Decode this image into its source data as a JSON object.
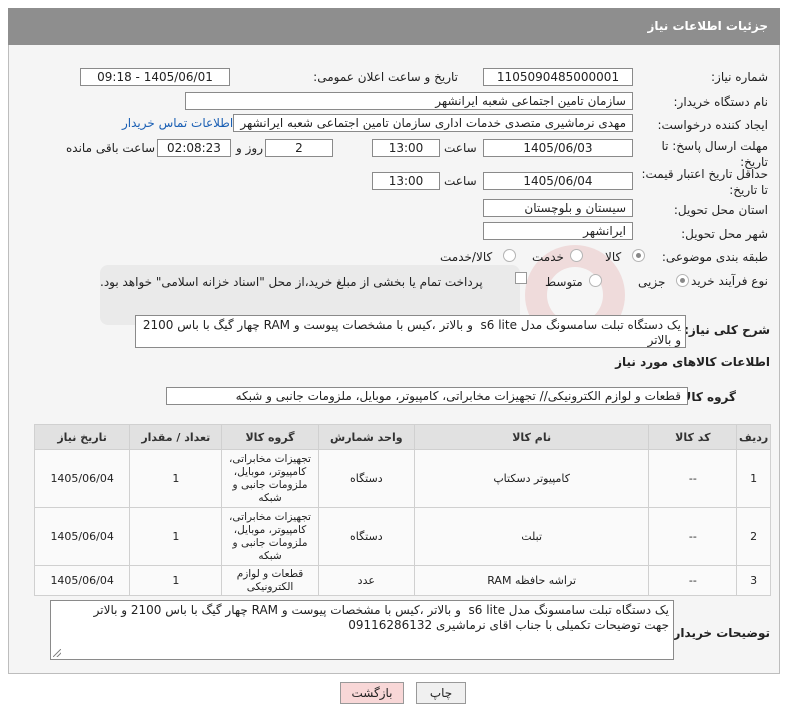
{
  "header": {
    "title": "جزئیات اطلاعات نیاز"
  },
  "fields": {
    "need_number_label": "شماره نیاز:",
    "need_number": "1105090485000001",
    "announce_label": "تاریخ و ساعت اعلان عمومی:",
    "announce_value": "1405/06/01 - 09:18",
    "buyer_label": "نام دستگاه خریدار:",
    "buyer_value": "سازمان تامین اجتماعی شعبه ایرانشهر",
    "creator_label": "ایجاد کننده درخواست:",
    "creator_value": "مهدی نرماشیری متصدی خدمات اداری سازمان تامین اجتماعی شعبه ایرانشهر",
    "contact_link": "اطلاعات تماس خریدار",
    "deadline_label": "مهلت ارسال پاسخ: تا تاریخ:",
    "deadline_date": "1405/06/03",
    "time_label": "ساعت",
    "deadline_time": "13:00",
    "days_value": "2",
    "days_label": "روز و",
    "remaining_time": "02:08:23",
    "remaining_label": "ساعت باقی مانده",
    "validity_label": "حداقل تاریخ اعتبار قیمت: تا تاریخ:",
    "validity_date": "1405/06/04",
    "validity_time": "13:00",
    "province_label": "استان محل تحویل:",
    "province_value": "سیستان و بلوچستان",
    "city_label": "شهر محل تحویل:",
    "city_value": "ایرانشهر",
    "category_label": "طبقه بندی موضوعی:",
    "category_options": [
      "کالا",
      "خدمت",
      "کالا/خدمت"
    ],
    "process_label": "نوع فرآیند خرید :",
    "process_options": [
      "جزیی",
      "متوسط"
    ],
    "payment_note": "پرداخت تمام یا بخشی از مبلغ خرید،از محل \"اسناد خزانه اسلامی\" خواهد بود."
  },
  "description": {
    "label": "شرح کلی نیاز:",
    "text": "یک دستگاه تبلت سامسونگ مدل s6 lite  و بالاتر ،کیس با مشخصات پیوست و RAM چهار گیگ با باس 2100 و بالاتر"
  },
  "goods_info": {
    "title": "اطلاعات کالاهای مورد نیاز"
  },
  "goods_group": {
    "label": "گروه کالا:",
    "value": "قطعات و لوازم الکترونیکی// تجهیزات مخابراتی، کامپیوتر، موبایل، ملزومات جانبی و شبکه"
  },
  "table": {
    "headers": [
      "ردیف",
      "کد کالا",
      "نام کالا",
      "واحد شمارش",
      "گروه کالا",
      "تعداد / مقدار",
      "تاریخ نیاز"
    ],
    "rows": [
      {
        "index": "1",
        "code": "--",
        "name": "کامپیوتر دسکتاپ",
        "unit": "دستگاه",
        "group": "تجهیزات مخابراتی، کامپیوتر، موبایل، ملزومات جانبی و شبکه",
        "qty": "1",
        "date": "1405/06/04"
      },
      {
        "index": "2",
        "code": "--",
        "name": "تبلت",
        "unit": "دستگاه",
        "group": "تجهیزات مخابراتی، کامپیوتر، موبایل، ملزومات جانبی و شبکه",
        "qty": "1",
        "date": "1405/06/04"
      },
      {
        "index": "3",
        "code": "--",
        "name": "تراشه حافظه RAM",
        "unit": "عدد",
        "group": "قطعات و لوازم الکترونیکی",
        "qty": "1",
        "date": "1405/06/04"
      }
    ]
  },
  "buyer_notes": {
    "label": "توضیحات خریدار:",
    "text": "یک دستگاه تبلت سامسونگ مدل s6 lite  و بالاتر ،کیس با مشخصات پیوست و RAM چهار گیگ با باس 2100 و بالاتر\nجهت توضیحات تکمیلی با جناب اقای نرماشیری 09116286132"
  },
  "buttons": {
    "print": "چاپ",
    "back": "بازگشت"
  },
  "colors": {
    "header_bg": "#8e8e8e",
    "panel_bg": "#f5f5f5",
    "link": "#1a5fb4",
    "back_button": "#f8d7d7"
  }
}
